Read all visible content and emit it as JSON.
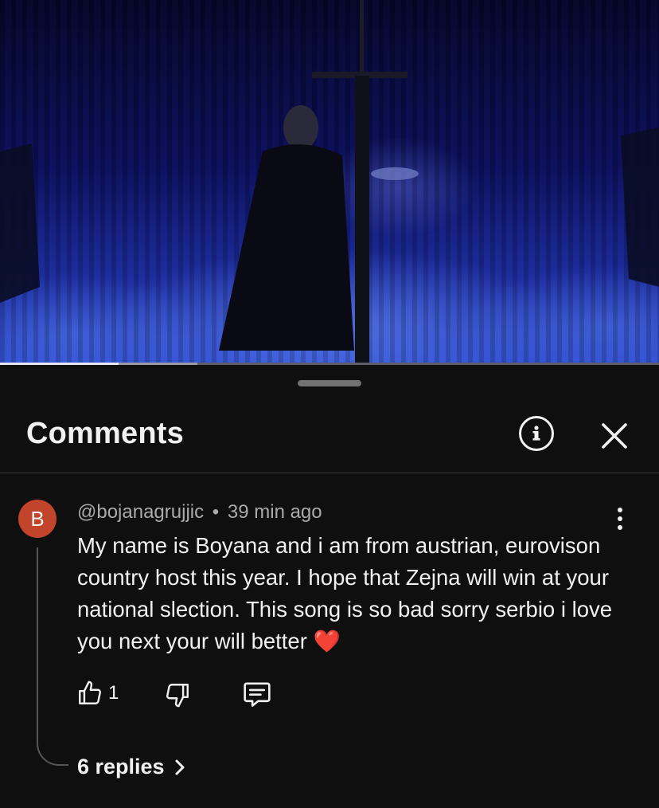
{
  "video": {
    "progress_played": 0.18,
    "progress_buffered": 0.3
  },
  "sheet": {
    "title": "Comments",
    "info_icon": "info-circle-icon",
    "close_icon": "close-icon"
  },
  "comment": {
    "avatar_letter": "B",
    "avatar_color": "#c2442b",
    "author": "@bojanagrujjic",
    "separator": "•",
    "time": "39 min ago",
    "text": "My name is Boyana and i am from austrian, eurovison country host this year. I hope that Zejna will win at your national slection. This song is so bad sorry serbio i love you next your will better",
    "emoji": "❤️",
    "like_count": "1",
    "replies_label": "6 replies"
  }
}
